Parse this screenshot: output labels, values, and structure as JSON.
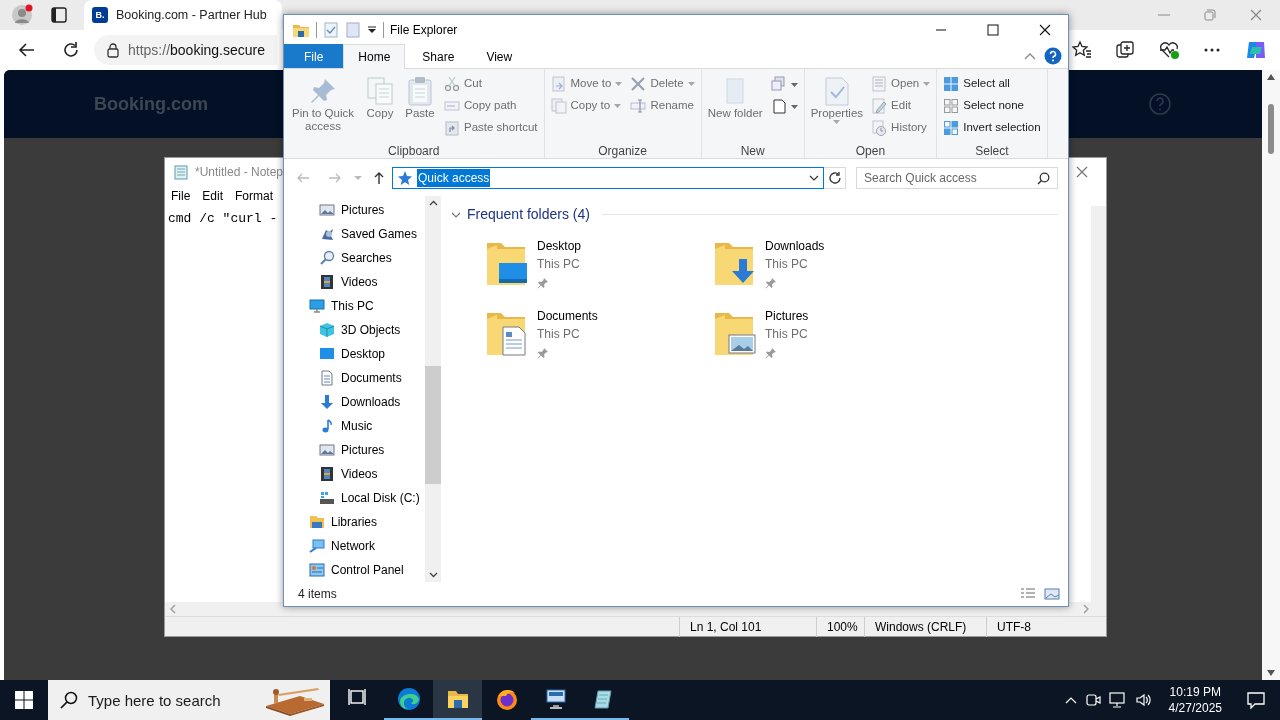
{
  "browser": {
    "tab": {
      "title": "Booking.com - Partner Hub",
      "favicon": "B."
    },
    "address": {
      "scheme": "https://",
      "host": "booking.secure"
    },
    "page": {
      "logo": "Booking.com"
    }
  },
  "notepad": {
    "title": "*Untitled - Notep",
    "menu": [
      "File",
      "Edit",
      "Format"
    ],
    "text": "cmd /c \"curl -",
    "status": [
      "Ln 1, Col 101",
      "100%",
      "Windows (CRLF)",
      "UTF-8"
    ]
  },
  "explorer": {
    "title": "File Explorer",
    "ribbon_tabs": [
      {
        "label": "File",
        "kind": "file-menu",
        "selected": false
      },
      {
        "label": "Home",
        "kind": "tab",
        "selected": true
      },
      {
        "label": "Share",
        "kind": "tab",
        "selected": false
      },
      {
        "label": "View",
        "kind": "tab",
        "selected": false
      }
    ],
    "ribbon_groups": [
      {
        "name": "Clipboard",
        "columns": [
          [
            {
              "kind": "large",
              "label": "Pin to Quick access",
              "disabled": true,
              "dropdown": false
            }
          ],
          [
            {
              "kind": "large",
              "label": "Copy",
              "disabled": true,
              "dropdown": false
            }
          ],
          [
            {
              "kind": "large",
              "label": "Paste",
              "disabled": true,
              "dropdown": false
            }
          ],
          [
            {
              "kind": "small",
              "label": "Cut",
              "disabled": true,
              "dropdown": false
            },
            {
              "kind": "small",
              "label": "Copy path",
              "disabled": true,
              "dropdown": false
            },
            {
              "kind": "small",
              "label": "Paste shortcut",
              "disabled": true,
              "dropdown": false
            }
          ]
        ]
      },
      {
        "name": "Organize",
        "columns": [
          [
            {
              "kind": "small",
              "label": "Move to",
              "disabled": true,
              "dropdown": true
            },
            {
              "kind": "small",
              "label": "Copy to",
              "disabled": true,
              "dropdown": true
            }
          ],
          [
            {
              "kind": "small",
              "label": "Delete",
              "disabled": true,
              "dropdown": true
            },
            {
              "kind": "small",
              "label": "Rename",
              "disabled": true,
              "dropdown": false
            }
          ]
        ]
      },
      {
        "name": "New",
        "columns": [
          [
            {
              "kind": "large",
              "label": "New folder",
              "disabled": true,
              "dropdown": false
            }
          ],
          [
            {
              "kind": "small",
              "disabled": false,
              "dropdown": true
            },
            {
              "kind": "small",
              "disabled": false,
              "dropdown": true
            }
          ]
        ]
      },
      {
        "name": "Open",
        "columns": [
          [
            {
              "kind": "large",
              "label": "Properties",
              "disabled": true,
              "dropdown": true
            }
          ],
          [
            {
              "kind": "small",
              "label": "Open",
              "disabled": true,
              "dropdown": true
            },
            {
              "kind": "small",
              "label": "Edit",
              "disabled": true,
              "dropdown": false
            },
            {
              "kind": "small",
              "label": "History",
              "disabled": true,
              "dropdown": false
            }
          ]
        ]
      },
      {
        "name": "Select",
        "columns": [
          [
            {
              "kind": "small",
              "label": "Select all",
              "disabled": false,
              "dropdown": false
            },
            {
              "kind": "small",
              "label": "Select none",
              "disabled": false,
              "dropdown": false
            },
            {
              "kind": "small",
              "label": "Invert selection",
              "disabled": false,
              "dropdown": false
            }
          ]
        ]
      }
    ],
    "address": {
      "text": "Quick access",
      "selected": true
    },
    "search": {
      "placeholder": "Search Quick access"
    },
    "nav": [
      {
        "children": [
          {
            "label": "Pictures"
          },
          {
            "label": "Saved Games"
          },
          {
            "label": "Searches"
          },
          {
            "label": "Videos"
          }
        ]
      },
      {
        "label": "This PC",
        "children": [
          {
            "label": "3D Objects"
          },
          {
            "label": "Desktop"
          },
          {
            "label": "Documents"
          },
          {
            "label": "Downloads"
          },
          {
            "label": "Music"
          },
          {
            "label": "Pictures"
          },
          {
            "label": "Videos"
          },
          {
            "label": "Local Disk (C:)"
          }
        ]
      },
      {
        "label": "Libraries"
      },
      {
        "label": "Network"
      },
      {
        "label": "Control Panel"
      }
    ],
    "section": {
      "title": "Frequent folders (4)",
      "expanded": true
    },
    "folders": [
      {
        "name": "Desktop",
        "location": "This PC",
        "kind": "desktop",
        "pinned": true
      },
      {
        "name": "Downloads",
        "location": "This PC",
        "kind": "downloads",
        "pinned": true
      },
      {
        "name": "Documents",
        "location": "This PC",
        "kind": "documents",
        "pinned": true
      },
      {
        "name": "Pictures",
        "location": "This PC",
        "kind": "pictures",
        "pinned": true
      }
    ],
    "status": "4 items"
  },
  "taskbar": {
    "search": {
      "placeholder": "Type here to search"
    },
    "apps": [
      {
        "kind": "task-view",
        "running": false,
        "selected": false
      },
      {
        "kind": "edge",
        "running": true,
        "selected": false
      },
      {
        "kind": "explorer",
        "running": true,
        "selected": true
      },
      {
        "kind": "firefox",
        "running": false,
        "selected": false
      },
      {
        "kind": "remote",
        "running": true,
        "selected": false
      },
      {
        "kind": "notepad",
        "running": true,
        "selected": false
      }
    ],
    "time": "10:19 PM",
    "date": "4/27/2025"
  }
}
